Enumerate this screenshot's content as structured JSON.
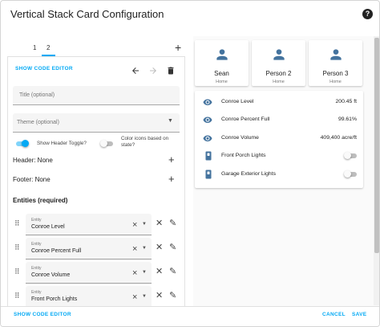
{
  "dialog": {
    "title": "Vertical Stack Card Configuration",
    "help_icon": "help-circle-icon"
  },
  "tabs": [
    {
      "label": "1",
      "selected": false
    },
    {
      "label": "2",
      "selected": true
    }
  ],
  "add_tab_icon": "plus-icon",
  "editor": {
    "show_code_editor": "SHOW CODE EDITOR",
    "title_placeholder": "Title (optional)",
    "theme_placeholder": "Theme (optional)",
    "show_header_toggle": {
      "label": "Show Header Toggle?",
      "on": true
    },
    "color_icons": {
      "label_line1": "Color icons based on",
      "label_line2": "state?",
      "on": false
    },
    "header": "Header: None",
    "footer": "Footer: None",
    "entities_heading": "Entities (required)",
    "entity_field_label": "Entity",
    "entities": [
      "Conroe Level",
      "Conroe Percent Full",
      "Conroe Volume",
      "Front Porch Lights"
    ]
  },
  "preview": {
    "persons": [
      {
        "name": "Sean",
        "state": "Home"
      },
      {
        "name": "Person 2",
        "state": "Home"
      },
      {
        "name": "Person 3",
        "state": "Home"
      }
    ],
    "entities": [
      {
        "name": "Conroe Level",
        "value": "200.45 ft",
        "icon": "eye-icon"
      },
      {
        "name": "Conroe Percent Full",
        "value": "99.61%",
        "icon": "eye-icon"
      },
      {
        "name": "Conroe Volume",
        "value": "409,400 acre/ft",
        "icon": "eye-icon"
      },
      {
        "name": "Front Porch Lights",
        "toggle": false,
        "icon": "switch-icon"
      },
      {
        "name": "Garage Exterior Lights",
        "toggle": false,
        "icon": "switch-icon"
      }
    ]
  },
  "footer": {
    "show_code_editor": "SHOW CODE EDITOR",
    "cancel": "CANCEL",
    "save": "SAVE"
  },
  "colors": {
    "accent": "#03a9f4",
    "icon": "#44739e"
  }
}
